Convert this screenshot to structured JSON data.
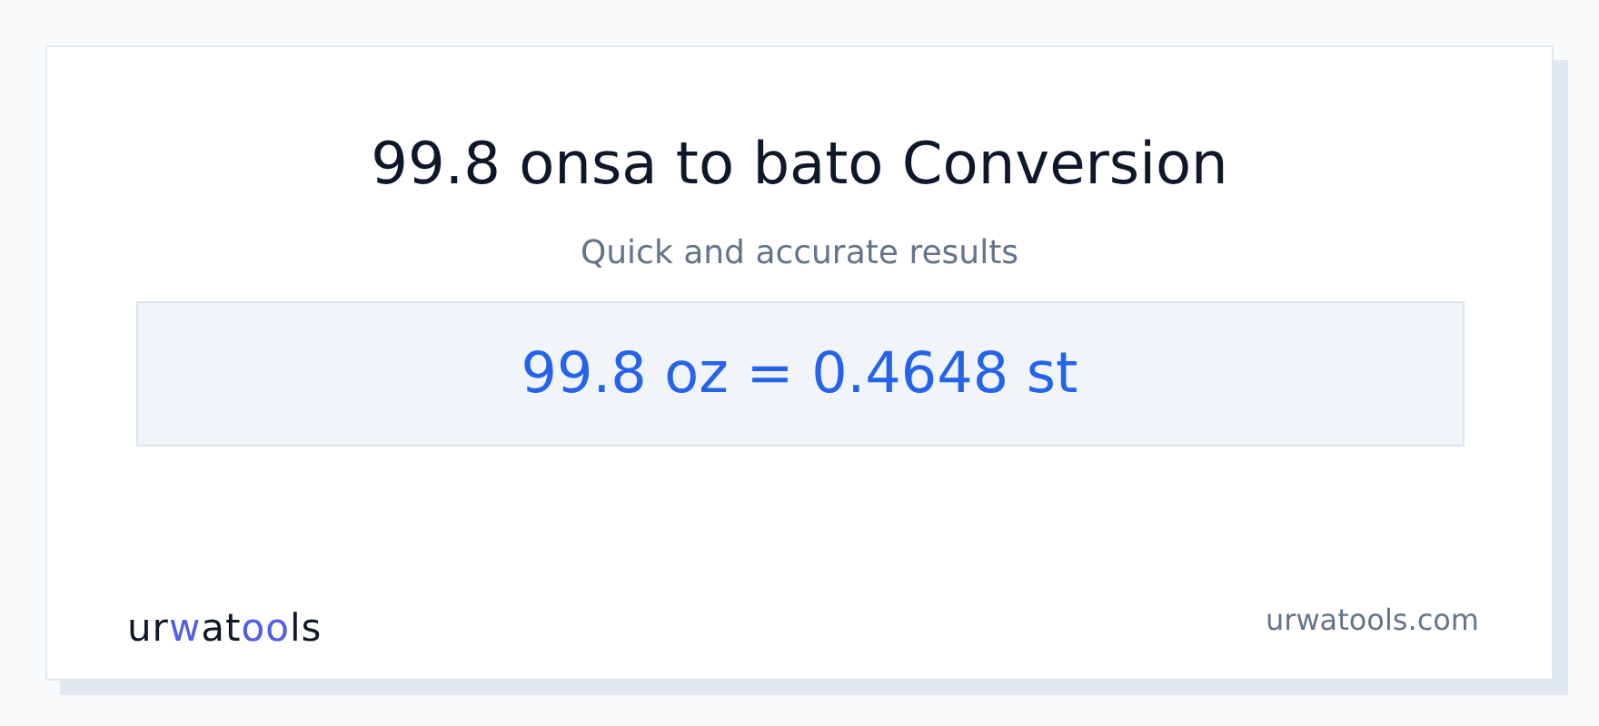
{
  "title": "99.8 onsa to bato Conversion",
  "subtitle": "Quick and accurate results",
  "result": "99.8 oz = 0.4648 st",
  "logo": [
    {
      "text": "ur",
      "accent": false
    },
    {
      "text": "w",
      "accent": true
    },
    {
      "text": "at",
      "accent": false
    },
    {
      "text": "oo",
      "accent": true
    },
    {
      "text": "ls",
      "accent": false
    }
  ],
  "site": "urwatools.com"
}
